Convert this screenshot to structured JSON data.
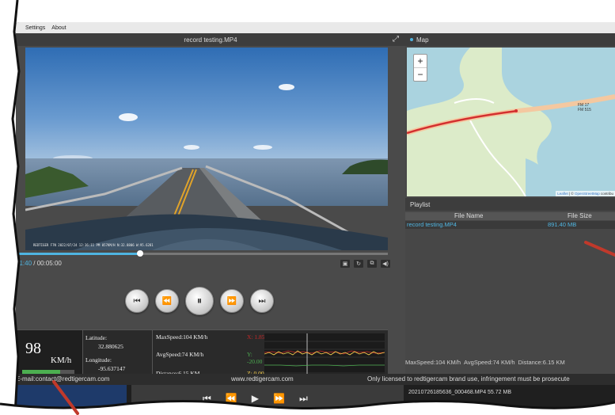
{
  "menu": {
    "items": [
      "Settings",
      "About"
    ]
  },
  "player": {
    "title": "record testing.MP4",
    "overlay": "REDTIGER F7N 2022/07/24 12:36:11 PM 057KM/H N:32.8806 W:95.6281",
    "current_time": "01:40",
    "total_time": "/ 00:05:00",
    "progress_fraction": 0.333
  },
  "stats": {
    "speed_value": "98",
    "speed_unit": "KM/h",
    "latitude_label": "Latitude:",
    "latitude_value": "32.880625",
    "longitude_label": "Longitude:",
    "longitude_value": "-95.637147",
    "max_speed": "MaxSpeed:104 KM/h",
    "avg_speed": "AvgSpeed:74 KM/h",
    "distance": "Distance:6.15 KM",
    "x_axis": "X: 1.85",
    "y_axis": "Y: -20.00",
    "z_axis": "Z: 0.00",
    "colors": {
      "x": "#c62828",
      "y": "#4caf50",
      "z": "#ffd54f"
    }
  },
  "map": {
    "title": "Map",
    "zoom_in": "+",
    "zoom_out": "−",
    "road_label_1": "FM 17",
    "road_label_2": "FM 515",
    "attribution_leaflet": "Leaflet",
    "attribution_sep": " | © ",
    "attribution_osm": "OpenStreetMap",
    "attribution_tail": " contribu"
  },
  "playlist": {
    "title": "Playlist",
    "col_name": "File Name",
    "col_size": "File Size",
    "rows": [
      {
        "name": "record testing.MP4",
        "size": "891.40 MB"
      }
    ],
    "summary_max": "MaxSpeed:104 KM/h",
    "summary_avg": "AvgSpeed:74 KM/h",
    "summary_dist": "Distance:6.15 KM"
  },
  "footer": {
    "email": "E-mail:contact@redtigercam.com",
    "website": "www.redtigercam.com",
    "license": "Only licensed to redtigercam brand use, infringement must be prosecute"
  },
  "background_window": {
    "file": "20210726185636_000468.MP4   55.72 MB"
  }
}
